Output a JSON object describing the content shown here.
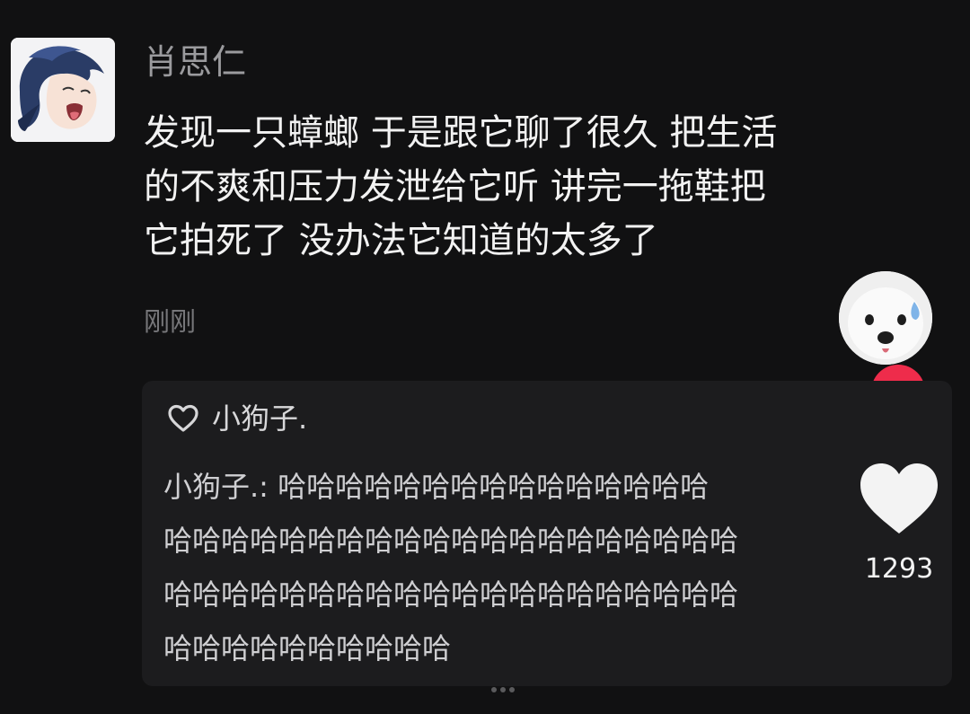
{
  "post": {
    "author": "肖思仁",
    "lines": [
      "发现一只蟑螂 于是跟它聊了很久 把生活",
      "的不爽和压力发泄给它听 讲完一拖鞋把",
      "它拍死了 没办法它知道的太多了"
    ],
    "timestamp": "刚刚"
  },
  "comment_card": {
    "header_label": "小狗子.",
    "comment_lines": [
      "小狗子.: 哈哈哈哈哈哈哈哈哈哈哈哈哈哈哈",
      "哈哈哈哈哈哈哈哈哈哈哈哈哈哈哈哈哈哈哈哈",
      "哈哈哈哈哈哈哈哈哈哈哈哈哈哈哈哈哈哈哈哈",
      "哈哈哈哈哈哈哈哈哈哈"
    ]
  },
  "actions": {
    "like_count": "1293"
  },
  "icons": {
    "follow": "plus-icon",
    "like": "heart-icon",
    "comment_heart": "heart-outline-icon"
  },
  "colors": {
    "background": "#111112",
    "follow_button": "#ee2c4b",
    "card": "#1c1c1e"
  }
}
